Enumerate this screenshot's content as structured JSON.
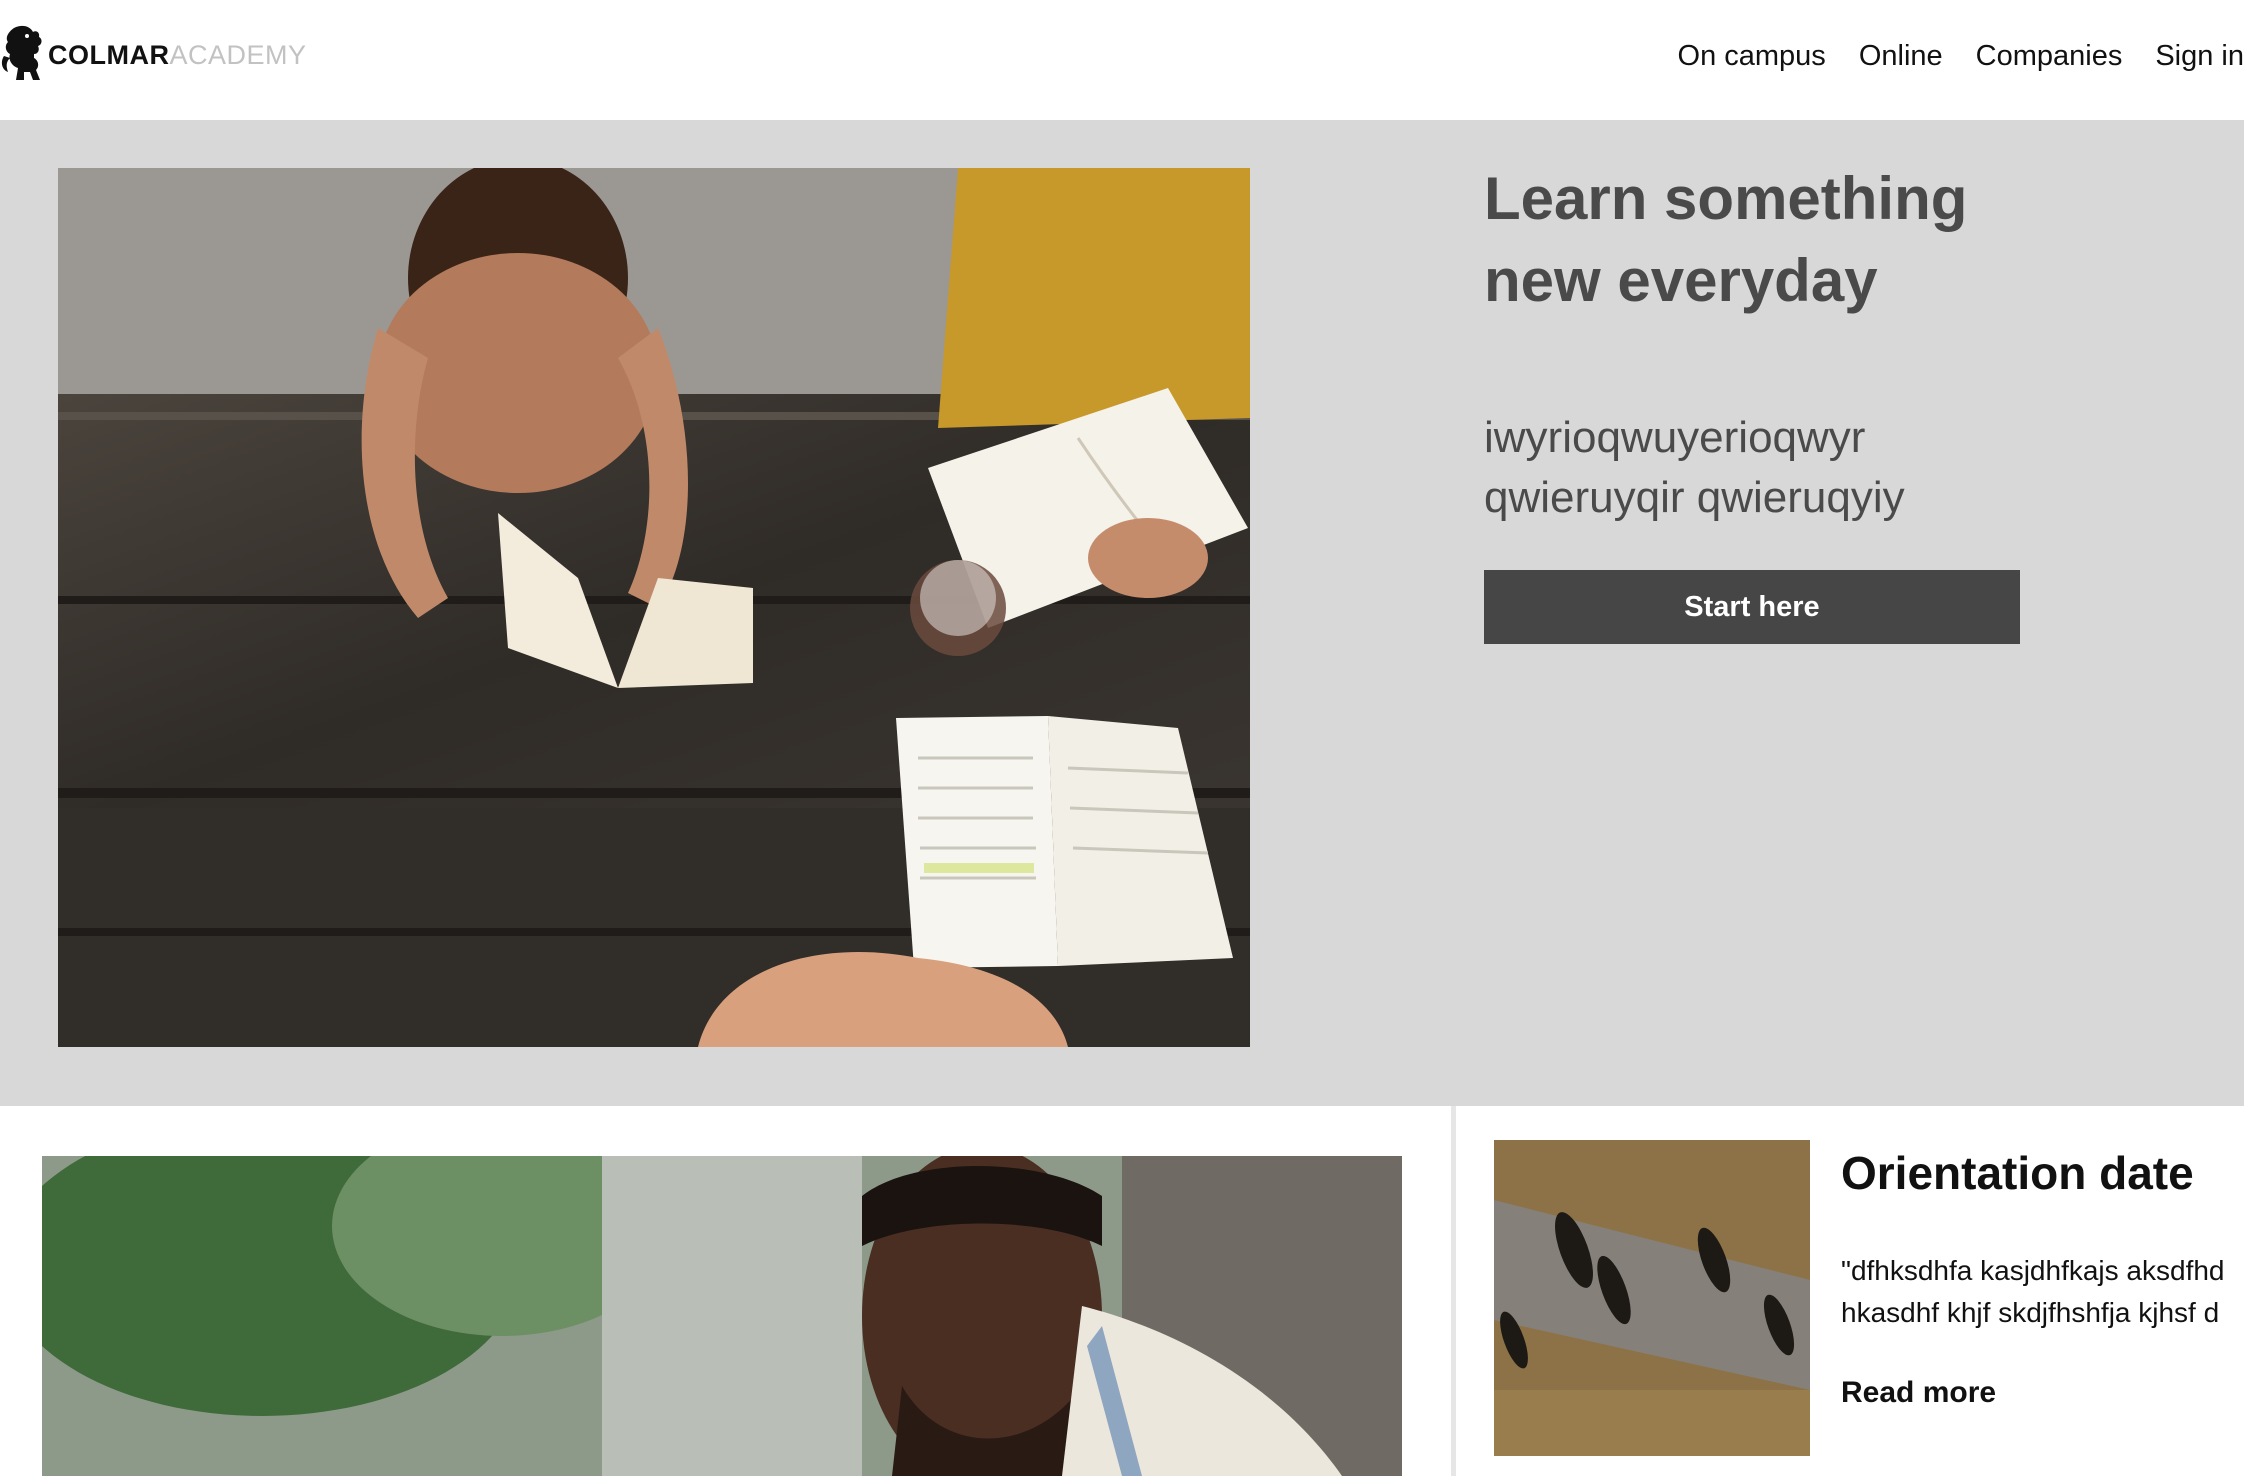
{
  "header": {
    "logo": {
      "primary": "COLMAR",
      "secondary": "ACADEMY",
      "icon": "lion-crest-icon"
    },
    "nav": [
      "On campus",
      "Online",
      "Companies",
      "Sign in"
    ]
  },
  "hero": {
    "title_line1": "Learn something",
    "title_line2": "new everyday",
    "subtitle_line1": "iwyrioqwuyerioqwyr",
    "subtitle_line2": "qwieruyqir qwieruqyiy",
    "cta_label": "Start here",
    "image": "students-reading-at-picnic-table-photo"
  },
  "lower": {
    "image": "smiling-man-outdoors-photo"
  },
  "event": {
    "image": "aerial-people-walking-shadows-photo",
    "title": "Orientation date",
    "text_line1": "\"dfhksdhfa kasjdhfkajs aksdfhd",
    "text_line2": "hkasdhf khjf skdjfhshfja kjhsf d",
    "link": "Read more"
  },
  "colors": {
    "hero_background": "#d8d8d8",
    "hero_text": "#4a4a4a",
    "button_background": "#464646",
    "button_text": "#ffffff",
    "logo_secondary": "#c2c2c2"
  }
}
